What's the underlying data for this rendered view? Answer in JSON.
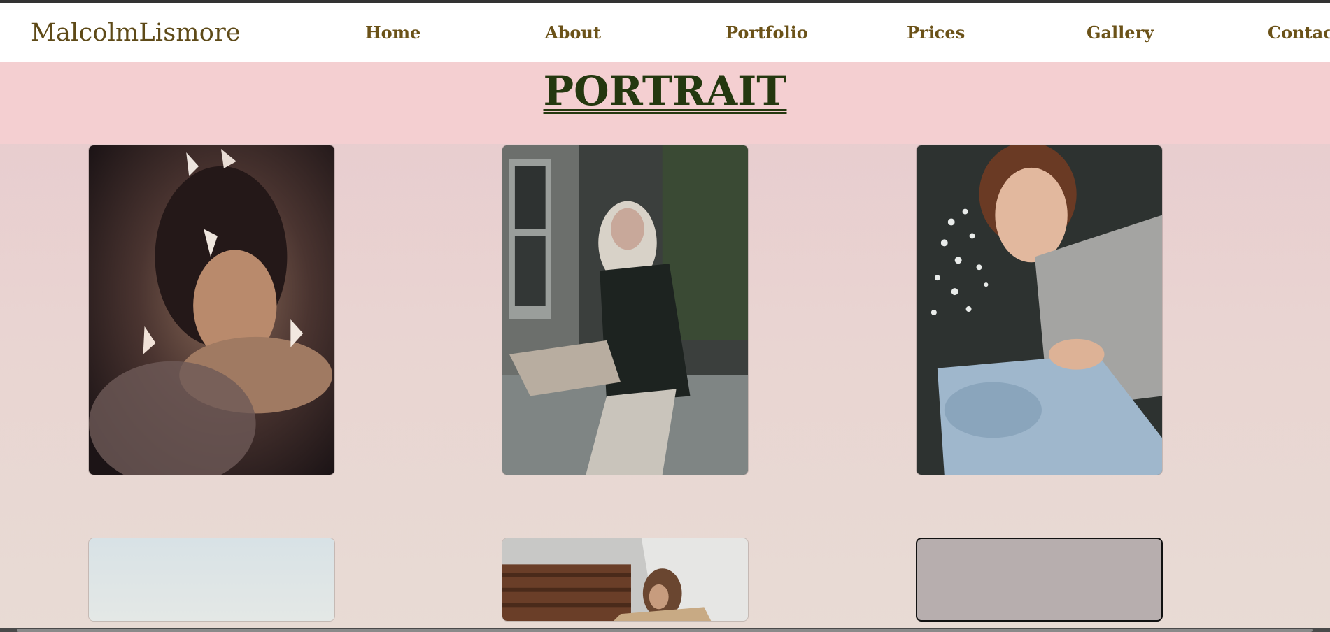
{
  "brand": {
    "name": "MalcolmLismore"
  },
  "nav": {
    "items": [
      {
        "label": "Home"
      },
      {
        "label": "About"
      },
      {
        "label": "Portfolio"
      },
      {
        "label": "Prices"
      },
      {
        "label": "Gallery"
      },
      {
        "label": "Contact"
      }
    ]
  },
  "hero": {
    "title": "PORTRAIT"
  },
  "gallery": {
    "items": [
      {
        "subject": "woman-with-butterflies-portrait"
      },
      {
        "subject": "woman-in-plaid-shirt-sitting"
      },
      {
        "subject": "woman-holding-flowers"
      },
      {
        "subject": "sky-landscape"
      },
      {
        "subject": "woman-by-wooden-house"
      },
      {
        "subject": "empty-placeholder"
      }
    ]
  },
  "colors": {
    "brand_text": "#5e4a18",
    "nav_text": "#6b5218",
    "hero_bg": "#f4cfd1",
    "title_text": "#24380f",
    "placeholder_bg": "#b7aeae"
  }
}
